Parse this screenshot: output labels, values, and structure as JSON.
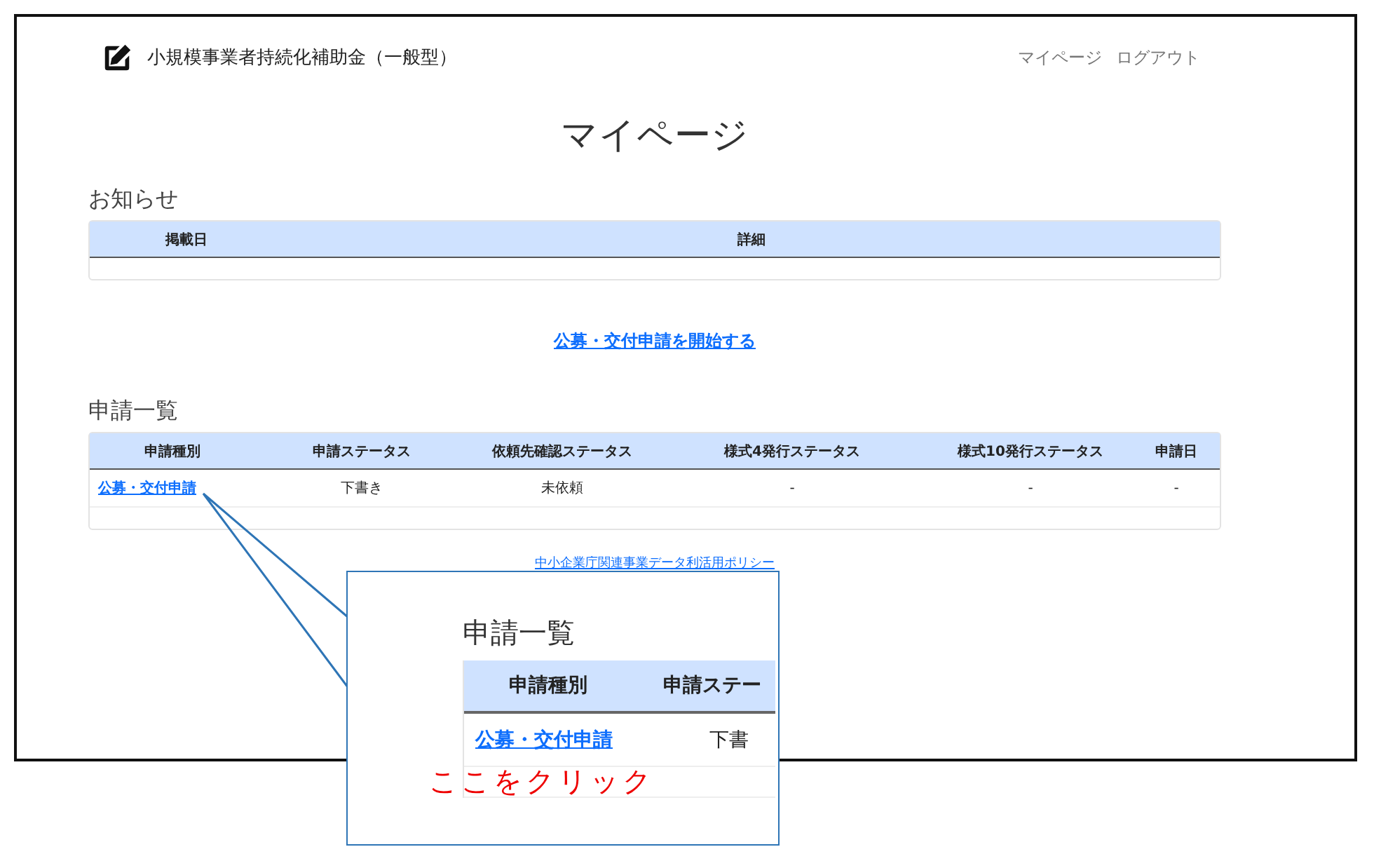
{
  "header": {
    "title": "小規模事業者持続化補助金（一般型）",
    "nav": [
      "マイページ",
      "ログアウト"
    ]
  },
  "page_title": "マイページ",
  "notices": {
    "heading": "お知らせ",
    "columns": [
      "掲載日",
      "詳細"
    ]
  },
  "start_link": "公募・交付申請を開始する",
  "applications": {
    "heading": "申請一覧",
    "columns": [
      "申請種別",
      "申請ステータス",
      "依頼先確認ステータス",
      "様式4発行ステータス",
      "様式10発行ステータス",
      "申請日"
    ],
    "rows": [
      {
        "cells": [
          {
            "kind": "link",
            "text": "公募・交付申請"
          },
          {
            "kind": "text",
            "text": "下書き"
          },
          {
            "kind": "text",
            "text": "未依頼"
          },
          {
            "kind": "text",
            "text": "-"
          },
          {
            "kind": "text",
            "text": "-"
          },
          {
            "kind": "text",
            "text": "-"
          }
        ]
      }
    ]
  },
  "footer_link": "中小企業庁関連事業データ利活用ポリシー",
  "callout": {
    "heading": "申請一覧",
    "columns": [
      "申請種別",
      "申請ステー"
    ],
    "rows": [
      {
        "cells": [
          {
            "kind": "link",
            "text": "公募・交付申請"
          },
          {
            "kind": "text",
            "text": "下書"
          }
        ]
      }
    ],
    "note": "ここをクリック"
  }
}
